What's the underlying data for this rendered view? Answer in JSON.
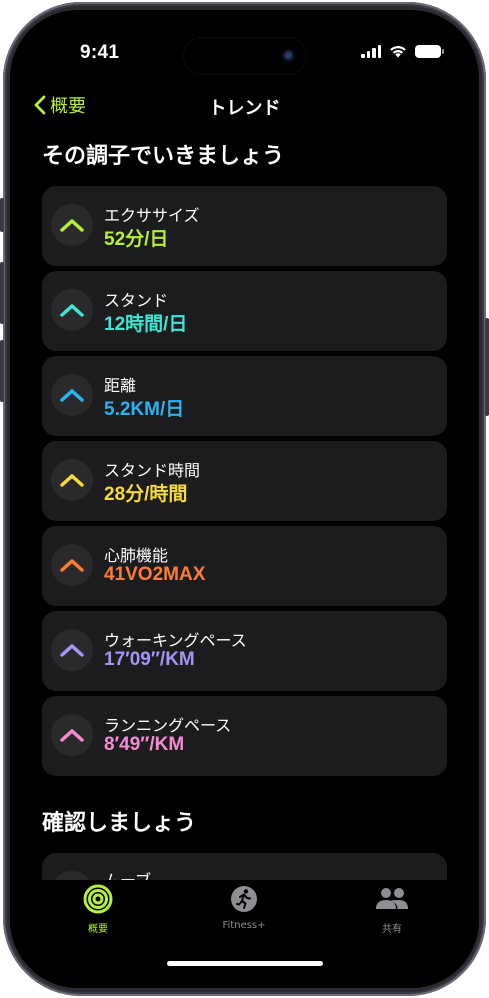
{
  "status_bar": {
    "time": "9:41"
  },
  "nav": {
    "back_label": "概要",
    "title": "トレンド"
  },
  "sections": {
    "keep_up": {
      "title": "その調子でいきましょう"
    },
    "check": {
      "title": "確認しましょう"
    }
  },
  "trends": [
    {
      "label": "エクササイズ",
      "value": "52分/日",
      "color": "#b6f03a",
      "icon": "chevron-up-icon"
    },
    {
      "label": "スタンド",
      "value": "12時間/日",
      "color": "#3ce6d2",
      "icon": "chevron-up-icon"
    },
    {
      "label": "距離",
      "value": "5.2KM/日",
      "color": "#28b4f0",
      "icon": "chevron-up-icon"
    },
    {
      "label": "スタンド時間",
      "value": "28分/時間",
      "color": "#f5dc37",
      "icon": "chevron-up-icon"
    },
    {
      "label": "心肺機能",
      "value": "41VO2MAX",
      "color": "#ff7d32",
      "icon": "chevron-up-icon"
    },
    {
      "label": "ウォーキングペース",
      "value": "17′09″/KM",
      "color": "#a596f5",
      "icon": "chevron-up-icon"
    },
    {
      "label": "ランニングペース",
      "value": "8′49″/KM",
      "color": "#f58cd2",
      "icon": "chevron-up-icon"
    }
  ],
  "check_items": [
    {
      "label": "ムーブ"
    }
  ],
  "tabs": [
    {
      "label": "概要",
      "icon": "activity-rings-icon",
      "active": true
    },
    {
      "label": "Fitness+",
      "icon": "runner-icon",
      "active": false
    },
    {
      "label": "共有",
      "icon": "people-icon",
      "active": false
    }
  ],
  "colors": {
    "accent": "#b6f03a",
    "card": "#1c1c1e",
    "inactive": "#8e8e93"
  }
}
